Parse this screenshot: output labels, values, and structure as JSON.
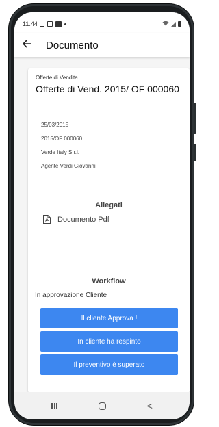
{
  "status_bar": {
    "time": "11:44",
    "icons": [
      "download-icon",
      "image-icon",
      "app-f-icon",
      "dot-icon",
      "wifi-icon",
      "signal-icon",
      "battery-icon"
    ]
  },
  "app_bar": {
    "back_icon": "arrow-left-icon",
    "title": "Documento"
  },
  "document": {
    "type_label": "Offerte di Vendita",
    "title": "Offerte di Vend. 2015/ OF 000060",
    "date": "25/03/2015",
    "number": "2015/OF 000060",
    "client": "Verde Italy S.r.l.",
    "agent": "Agente Verdi Giovanni"
  },
  "attachments": {
    "title": "Allegati",
    "items": [
      {
        "icon": "pdf-icon",
        "label": "Documento Pdf"
      }
    ]
  },
  "workflow": {
    "title": "Workflow",
    "status": "In approvazione Cliente",
    "actions": [
      {
        "label": "Il cliente Approva !"
      },
      {
        "label": "In cliente ha respinto"
      },
      {
        "label": "Il preventivo è superato"
      }
    ]
  },
  "nav_bar": {
    "recents_icon": "recents-icon",
    "home_icon": "home-icon",
    "back_icon": "chevron-left-icon",
    "back_glyph": "<"
  },
  "colors": {
    "accent": "#3d87f0",
    "frame": "#1a1d1f",
    "background": "#f5f5f5",
    "card": "#ffffff"
  }
}
